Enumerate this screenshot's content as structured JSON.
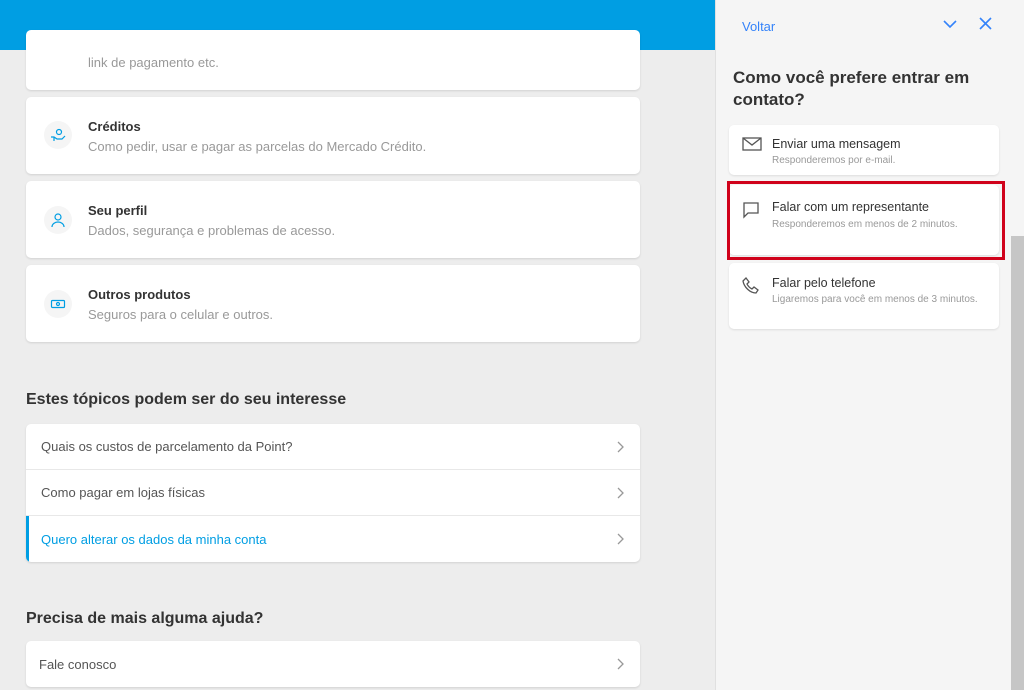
{
  "main": {
    "top_card": {
      "desc_line2": "link de pagamento etc."
    },
    "cards": [
      {
        "title": "Créditos",
        "desc": "Como pedir, usar e pagar as parcelas do Mercado Crédito.",
        "icon": "hand-coin-icon"
      },
      {
        "title": "Seu perfil",
        "desc": "Dados, segurança e problemas de acesso.",
        "icon": "user-icon"
      },
      {
        "title": "Outros produtos",
        "desc": "Seguros para o celular e outros.",
        "icon": "ticket-icon"
      }
    ],
    "topics_title": "Estes tópicos podem ser do seu interesse",
    "topics": [
      "Quais os custos de parcelamento da Point?",
      "Como pagar em lojas físicas",
      "Quero alterar os dados da minha conta"
    ],
    "help_title": "Precisa de mais alguma ajuda?",
    "help_items": [
      "Fale conosco"
    ]
  },
  "panel": {
    "back_label": "Voltar",
    "heading": "Como você prefere entrar em contato?",
    "options": [
      {
        "title": "Enviar uma mensagem",
        "desc": "Responderemos por e-mail.",
        "icon": "mail-icon"
      },
      {
        "title": "Falar com um representante",
        "desc": "Responderemos em menos de 2 minutos.",
        "icon": "chat-icon"
      },
      {
        "title": "Falar pelo telefone",
        "desc": "Ligaremos para você em menos de 3 minutos.",
        "icon": "phone-icon"
      }
    ]
  },
  "colors": {
    "brand_blue": "#009ee3",
    "link_blue": "#3483fa",
    "highlight_red": "#d0021b"
  }
}
